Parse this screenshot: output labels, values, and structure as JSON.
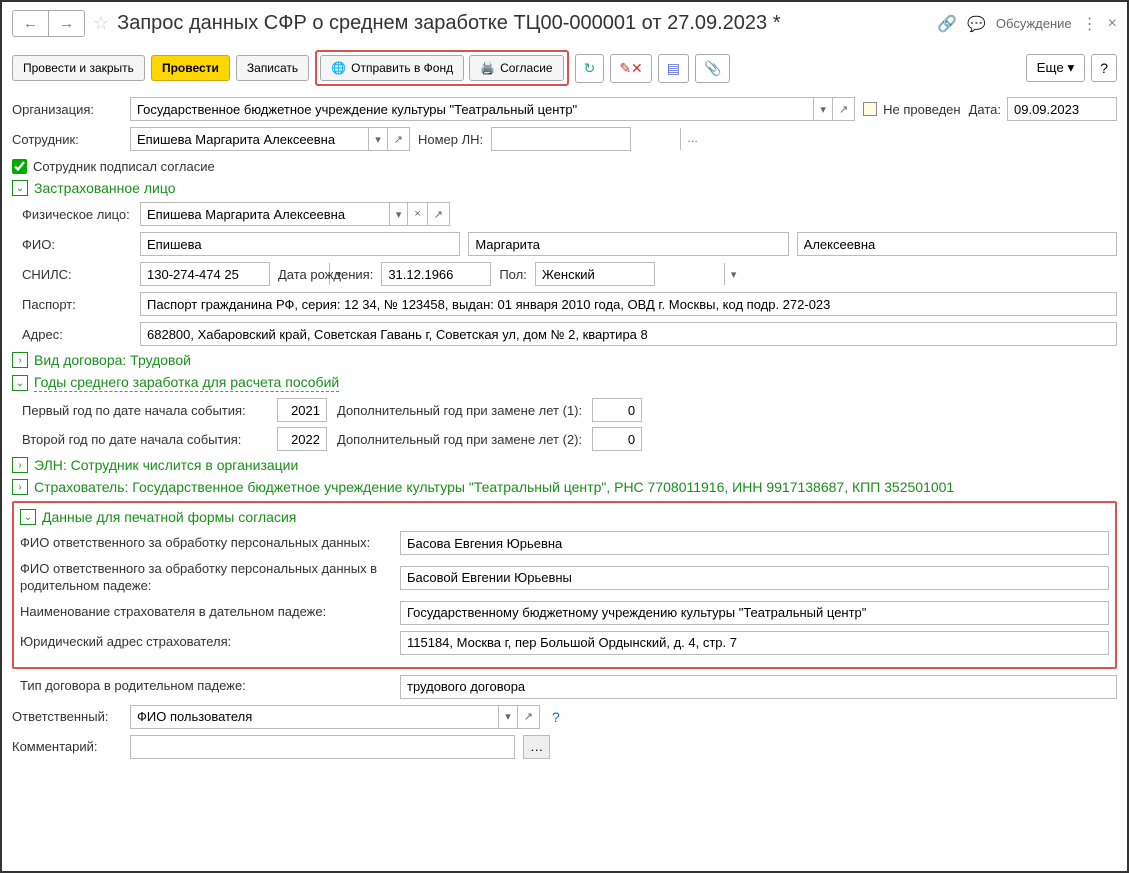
{
  "header": {
    "title": "Запрос данных СФР о среднем заработке ТЦ00-000001 от 27.09.2023 *",
    "discuss": "Обсуждение"
  },
  "toolbar": {
    "post_close": "Провести и закрыть",
    "post": "Провести",
    "save": "Записать",
    "send_fund": "Отправить в Фонд",
    "consent": "Согласие",
    "more": "Еще"
  },
  "form": {
    "org_label": "Организация:",
    "org_value": "Государственное бюджетное учреждение культуры \"Театральный центр\"",
    "not_posted": "Не проведен",
    "date_label": "Дата:",
    "date_value": "09.09.2023",
    "employee_label": "Сотрудник:",
    "employee_value": "Епишева Маргарита Алексеевна",
    "ln_label": "Номер ЛН:",
    "ln_value": "",
    "consent_signed": "Сотрудник подписал согласие"
  },
  "insured": {
    "title": "Застрахованное лицо",
    "phys_label": "Физическое лицо:",
    "phys_value": "Епишева Маргарита Алексеевна",
    "fio_label": "ФИО:",
    "surname": "Епишева",
    "name": "Маргарита",
    "patronymic": "Алексеевна",
    "snils_label": "СНИЛС:",
    "snils_value": "130-274-474 25",
    "dob_label": "Дата рождения:",
    "dob_value": "31.12.1966",
    "sex_label": "Пол:",
    "sex_value": "Женский",
    "passport_label": "Паспорт:",
    "passport_value": "Паспорт гражданина РФ, серия: 12 34, № 123458, выдан: 01 января 2010 года, ОВД г. Москвы, код подр. 272-023",
    "address_label": "Адрес:",
    "address_value": "682800, Хабаровский край, Советская Гавань г, Советская ул, дом № 2, квартира 8"
  },
  "contract": {
    "title": "Вид договора: Трудовой"
  },
  "years": {
    "title": "Годы среднего заработка для расчета пособий",
    "year1_label": "Первый год по дате начала события:",
    "year1_value": "2021",
    "year2_label": "Второй год по дате начала события:",
    "year2_value": "2022",
    "addyear1_label": "Дополнительный год при замене лет (1):",
    "addyear1_value": "0",
    "addyear2_label": "Дополнительный год при замене лет (2):",
    "addyear2_value": "0"
  },
  "eln": {
    "title": "ЭЛН: Сотрудник числится в организации"
  },
  "insurer": {
    "title": "Страхователь: Государственное бюджетное учреждение культуры \"Театральный центр\", РНС 7708011916, ИНН 9917138687, КПП 352501001"
  },
  "consent_form": {
    "title": "Данные для печатной формы согласия",
    "resp_label": "ФИО ответственного за обработку персональных данных:",
    "resp_value": "Басова Евгения Юрьевна",
    "resp_gen_label": "ФИО ответственного за обработку персональных данных в родительном падеже:",
    "resp_gen_value": "Басовой Евгении Юрьевны",
    "insurer_dat_label": "Наименование страхователя в дательном падеже:",
    "insurer_dat_value": "Государственному бюджетному учреждению культуры \"Театральный центр\"",
    "legal_addr_label": "Юридический адрес страхователя:",
    "legal_addr_value": "115184, Москва г, пер Большой Ордынский, д. 4, стр. 7"
  },
  "contract_gen": {
    "label": "Тип договора в родительном падеже:",
    "value": "трудового договора"
  },
  "responsible": {
    "label": "Ответственный:",
    "value": "ФИО пользователя"
  },
  "comment": {
    "label": "Комментарий:",
    "value": ""
  }
}
